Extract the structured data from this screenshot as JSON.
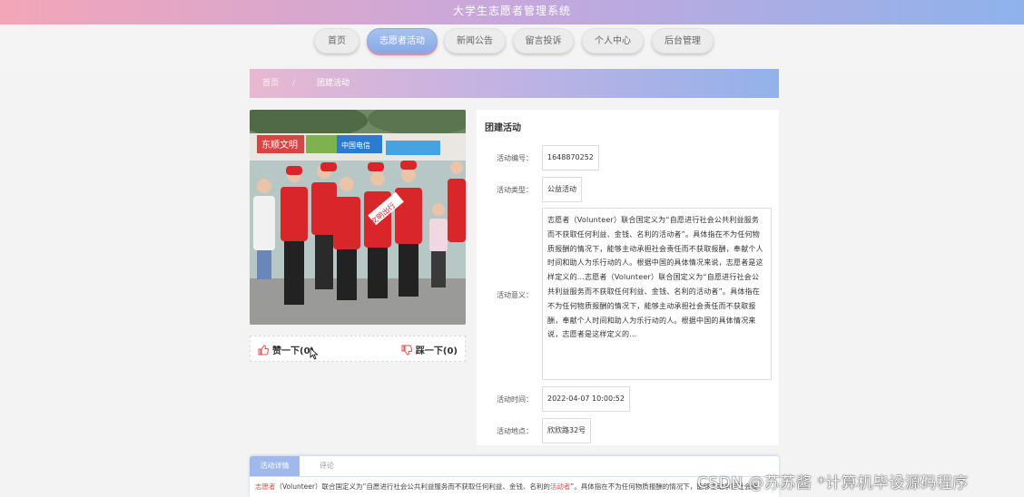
{
  "header": {
    "title": "大学生志愿者管理系统"
  },
  "nav": {
    "items": [
      {
        "label": "首页"
      },
      {
        "label": "志愿者活动"
      },
      {
        "label": "新闻公告"
      },
      {
        "label": "留言投诉"
      },
      {
        "label": "个人中心"
      },
      {
        "label": "后台管理"
      }
    ]
  },
  "breadcrumb": {
    "home": "首页",
    "separator": "/",
    "current": "团建活动"
  },
  "photo": {
    "signs": [
      "东顺文明",
      "中国电信",
      "文明出行"
    ]
  },
  "likes": {
    "like_label": "赞一下(0)",
    "dislike_label": "踩一下(0)"
  },
  "info": {
    "title": "团建活动",
    "rows": [
      {
        "label": "活动编号：",
        "value": "1648870252"
      },
      {
        "label": "活动类型：",
        "value": "公益活动"
      },
      {
        "label": "活动意义：",
        "value": "志愿者（Volunteer）联合国定义为“自愿进行社会公共利益服务而不获取任何利益、金钱、名利的活动者”。具体指在不为任何物质报酬的情况下，能够主动承担社会责任而不获取报酬，奉献个人时间和助人为乐行动的人。根据中国的具体情况来说，志愿者是这样定义的...志愿者（Volunteer）联合国定义为“自愿进行社会公共利益服务而不获取任何利益、金钱、名利的活动者”。具体指在不为任何物质报酬的情况下，能够主动承担社会责任而不获取报酬，奉献个人时间和助人为乐行动的人。根据中国的具体情况来说，志愿者是这样定义的..."
      },
      {
        "label": "活动时间：",
        "value": "2022-04-07 10:00:52"
      },
      {
        "label": "活动地点：",
        "value": "欣欣路32号"
      }
    ]
  },
  "tabs": {
    "detail": "活动详情",
    "comment": "评论"
  },
  "detail": {
    "highlight1": "志愿者",
    "text1": "（Volunteer）联合国定义为“自愿进行社会公共利益服务而不获取任何利益、金钱、名利的",
    "highlight2": "活动者",
    "text2": "”。具体指在不为任何物质报酬的情况下，能够主动承担社会责"
  },
  "watermark": "CSDN @苏苏酱    *计算机毕设源码程序",
  "colors": {
    "accent_pink": "#f3a6b8",
    "accent_blue": "#8fb2ec",
    "vest_red": "#d8262a"
  }
}
